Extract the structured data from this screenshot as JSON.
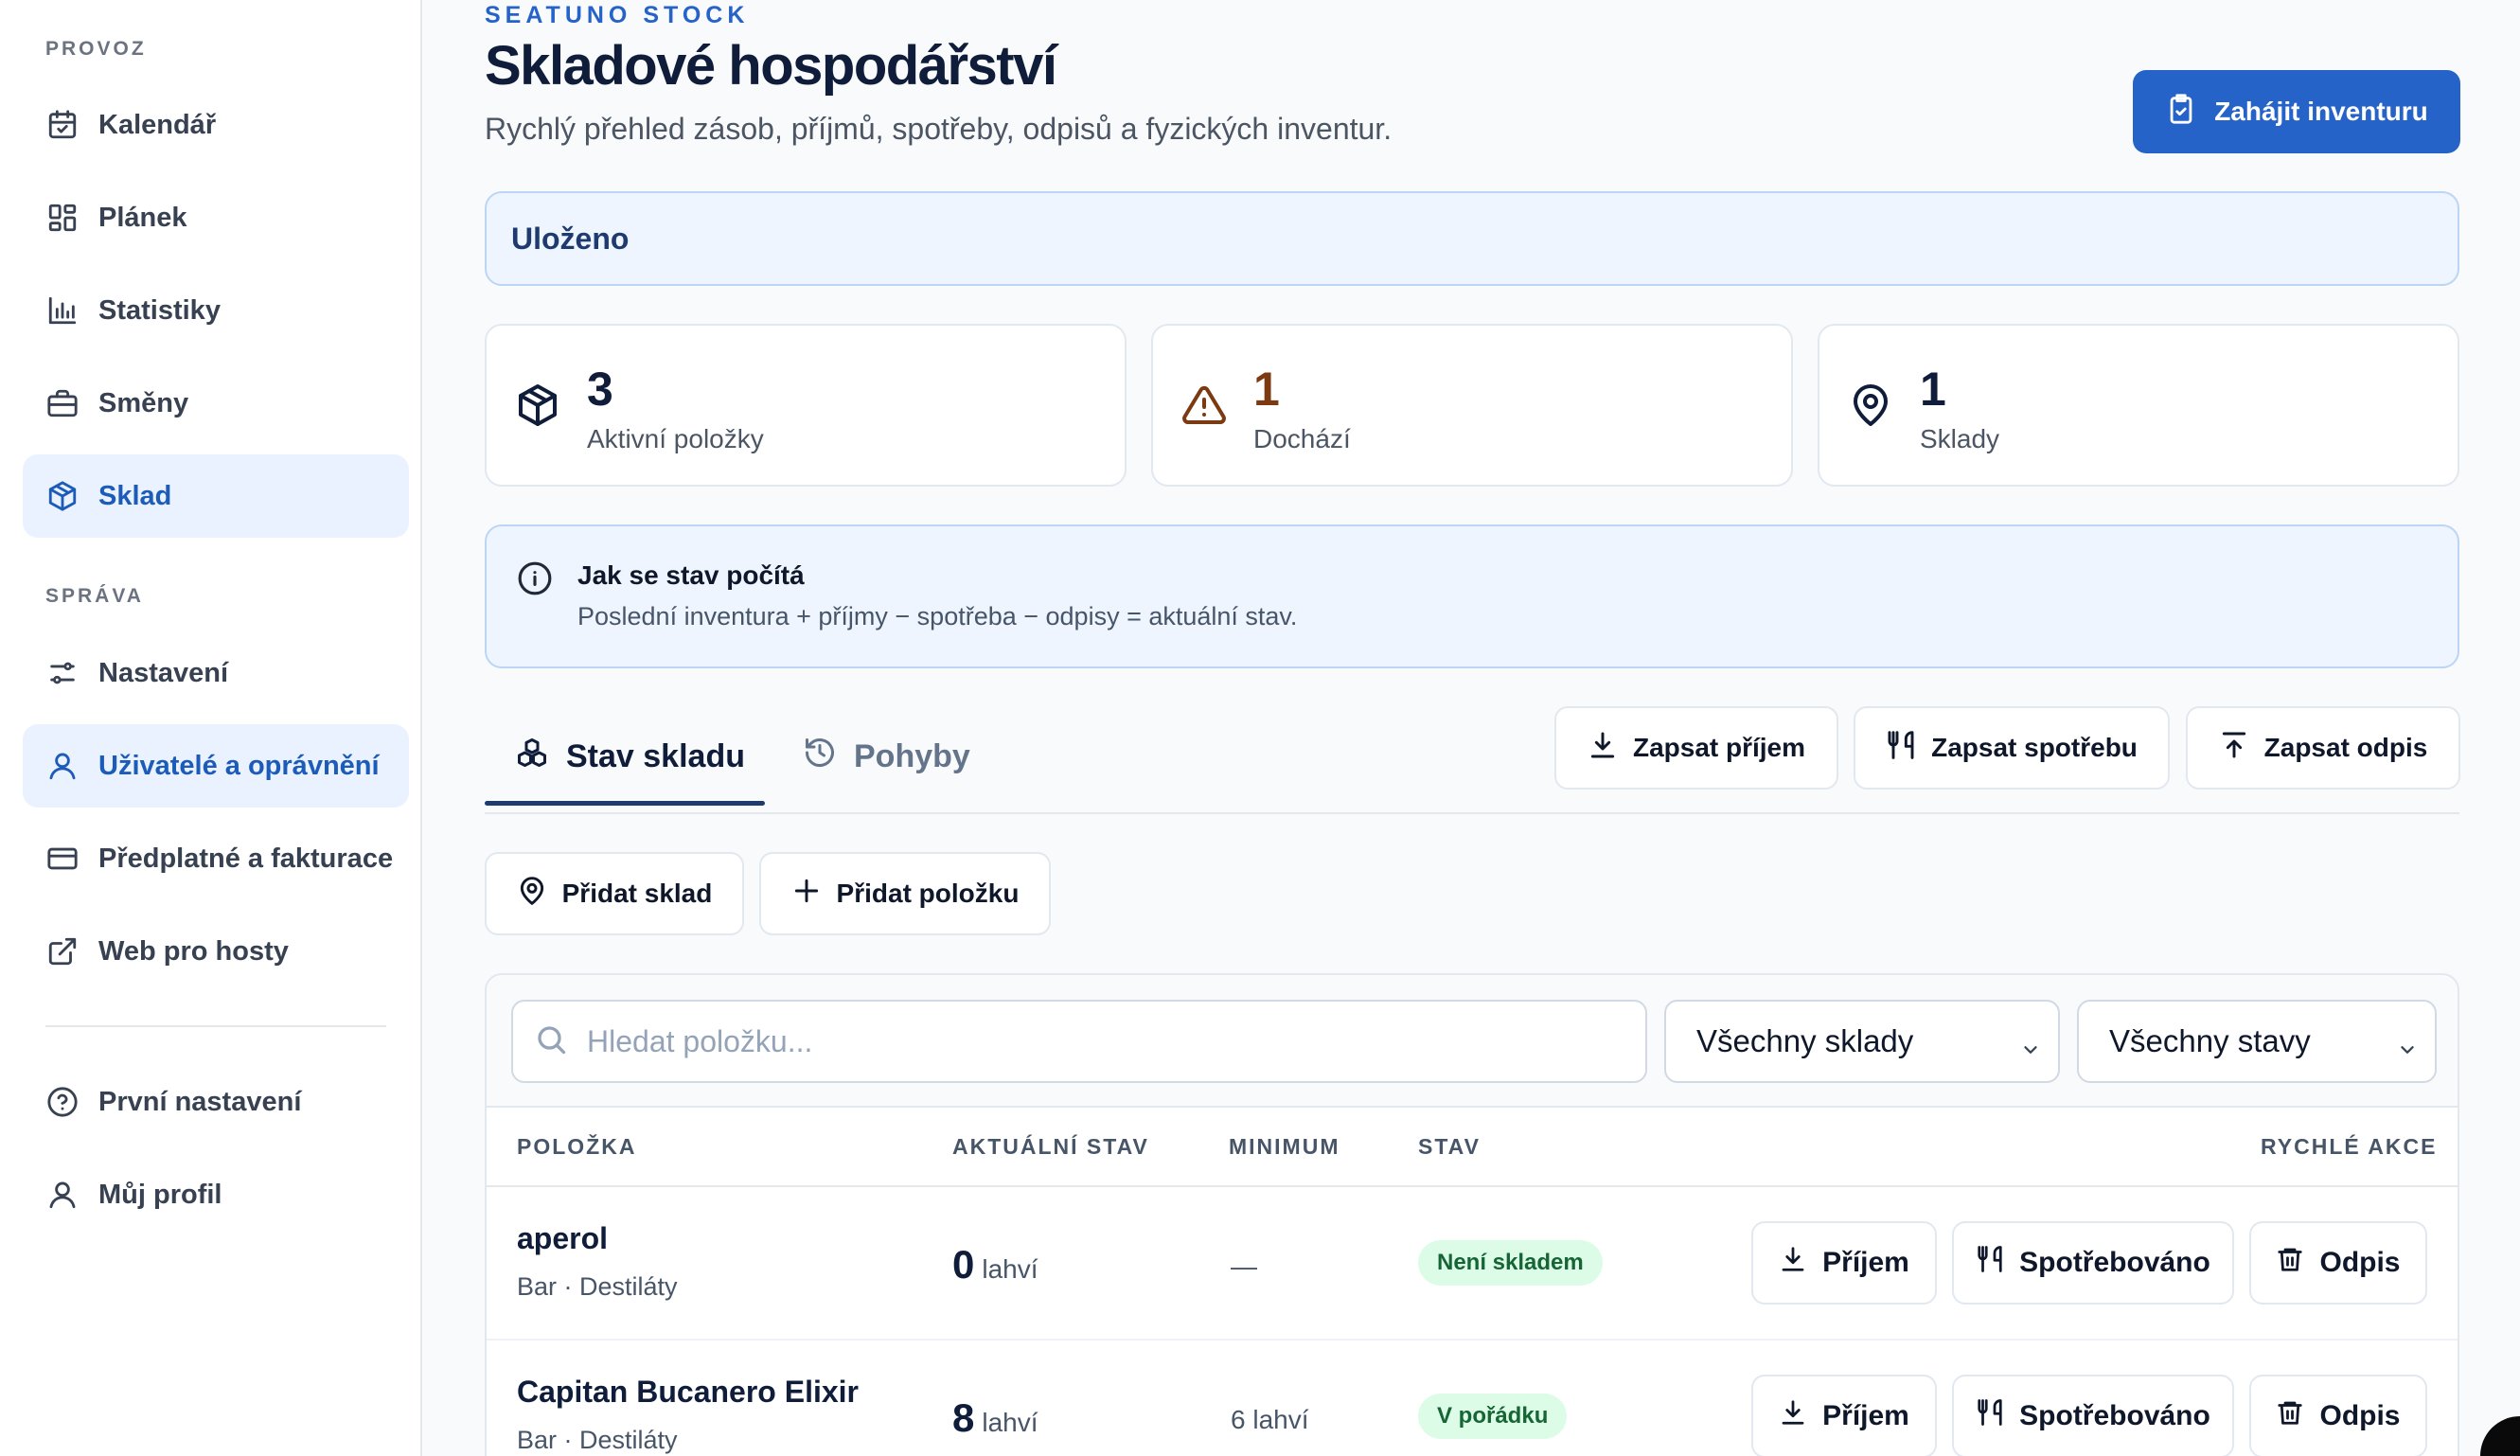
{
  "sidebar": {
    "section_provoz": "PROVOZ",
    "section_sprava": "SPRÁVA",
    "items": [
      {
        "label": "Kalendář",
        "icon": "calendar-icon"
      },
      {
        "label": "Plánek",
        "icon": "layout-grid-icon"
      },
      {
        "label": "Statistiky",
        "icon": "bar-chart-icon"
      },
      {
        "label": "Směny",
        "icon": "briefcase-icon"
      },
      {
        "label": "Sklad",
        "icon": "package-icon",
        "active": true
      },
      {
        "label": "Nastavení",
        "icon": "sliders-icon"
      },
      {
        "label": "Uživatelé a oprávnění",
        "icon": "user-icon",
        "active": true
      },
      {
        "label": "Předplatné a fakturace",
        "icon": "credit-card-icon"
      },
      {
        "label": "Web pro hosty",
        "icon": "external-link-icon"
      },
      {
        "label": "První nastavení",
        "icon": "help-circle-icon"
      },
      {
        "label": "Můj profil",
        "icon": "user-icon"
      }
    ]
  },
  "header": {
    "eyebrow": "SEATUNO STOCK",
    "title": "Skladové hospodářství",
    "subtitle": "Rychlý přehled zásob, příjmů, spotřeby, odpisů a fyzických inventur.",
    "primary_action": "Zahájit inventuru"
  },
  "banner": {
    "text": "Uloženo"
  },
  "stats": [
    {
      "value": "3",
      "label": "Aktivní položky",
      "color": "#0f1c3a",
      "icon": "package-icon"
    },
    {
      "value": "1",
      "label": "Dochází",
      "color": "#7c3a12",
      "icon": "warning-icon"
    },
    {
      "value": "1",
      "label": "Sklady",
      "color": "#0f1c3a",
      "icon": "map-pin-icon"
    }
  ],
  "info": {
    "title": "Jak se stav počítá",
    "text": "Poslední inventura + příjmy − spotřeba − odpisy = aktuální stav."
  },
  "tabs": [
    {
      "label": "Stav skladu",
      "active": true
    },
    {
      "label": "Pohyby",
      "active": false
    }
  ],
  "actions": {
    "record_receipt": "Zapsat příjem",
    "record_consumption": "Zapsat spotřebu",
    "record_writeoff": "Zapsat odpis",
    "add_warehouse": "Přidat sklad",
    "add_item": "Přidat položku"
  },
  "filters": {
    "search_placeholder": "Hledat položku...",
    "warehouse_selected": "Všechny sklady",
    "status_selected": "Všechny stavy"
  },
  "table": {
    "columns": [
      "POLOŽKA",
      "AKTUÁLNÍ STAV",
      "MINIMUM",
      "STAV",
      "RYCHLÉ AKCE"
    ],
    "rows": [
      {
        "name": "aperol",
        "category": "Bar · Destiláty",
        "qty": "0",
        "unit": "lahví",
        "minimum": "—",
        "status": "Není skladem"
      },
      {
        "name": "Capitan Bucanero Elixir",
        "category": "Bar · Destiláty",
        "qty": "8",
        "unit": "lahví",
        "minimum": "6 lahví",
        "status": "V pořádku"
      }
    ],
    "row_actions": {
      "receipt": "Příjem",
      "consumed": "Spotřebováno",
      "writeoff": "Odpis"
    }
  },
  "colors": {
    "accent": "#2563c9",
    "active_nav_bg": "#eaf2ff",
    "badge_bg": "#dcfce7",
    "warning": "#7c3a12"
  }
}
